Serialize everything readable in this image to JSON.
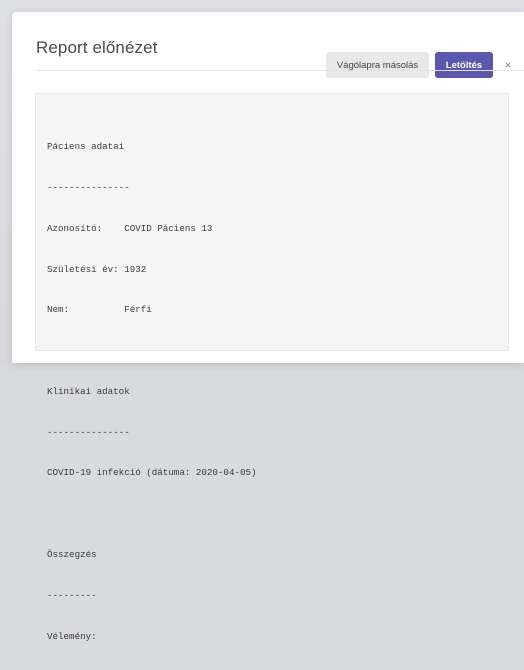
{
  "modal": {
    "title": "Report előnézet",
    "copy_label": "Vágólapra másolás",
    "download_label": "Letöltés",
    "close_glyph": "×"
  },
  "report": {
    "lines": [
      "Páciens adatai",
      "---------------",
      "Azonosító:    COVID Páciens 13",
      "Születési év: 1932",
      "Nem:          Férfi",
      "",
      "Klinikai adatok",
      "---------------",
      "COVID-19 infekció (dátuma: 2020-04-05)",
      "",
      "Összegzés",
      "---------",
      "Vélemény:"
    ]
  },
  "colors": {
    "primary_button": "#5b57b0",
    "secondary_button": "#e8e8eb",
    "report_background": "#f5f5f6"
  }
}
